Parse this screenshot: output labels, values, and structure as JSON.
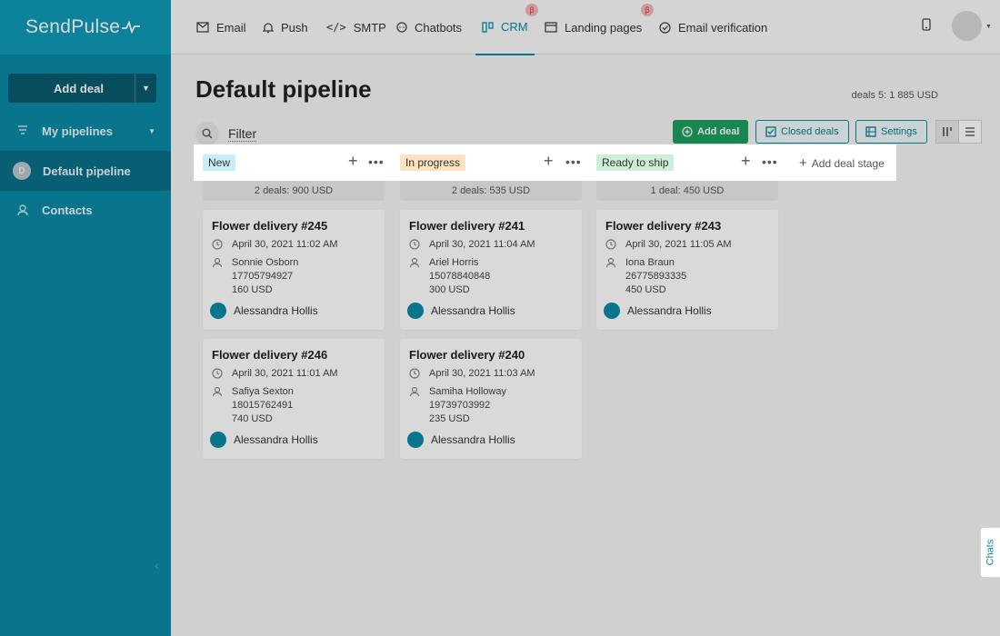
{
  "app": {
    "logo": "SendPulse"
  },
  "nav": {
    "email": "Email",
    "push": "Push",
    "smtp": "SMTP",
    "chatbots": "Chatbots",
    "crm": "CRM",
    "landing": "Landing pages",
    "verification": "Email verification",
    "beta": "β"
  },
  "sidebar": {
    "add_deal": "Add deal",
    "my_pipelines": "My pipelines",
    "default_pipeline": "Default pipeline",
    "pipeline_initial": "D",
    "contacts": "Contacts"
  },
  "page": {
    "title": "Default pipeline",
    "summary": "deals 5: 1 885 USD",
    "filter": "Filter"
  },
  "toolbar": {
    "add_deal": "Add deal",
    "closed_deals": "Closed deals",
    "settings": "Settings"
  },
  "stages": [
    {
      "name": "New",
      "color": "#c9eef7",
      "summary": "2 deals: 900 USD"
    },
    {
      "name": "In progress",
      "color": "#fbe3bf",
      "summary": "2 deals: 535 USD"
    },
    {
      "name": "Ready to ship",
      "color": "#cdeed8",
      "summary": "1 deal: 450 USD"
    }
  ],
  "add_stage": "Add deal stage",
  "cards": [
    {
      "title": "Flower delivery #245",
      "date": "April 30, 2021 11:02 AM",
      "contact": "Sonnie Osborn",
      "phone": "17705794927",
      "amount": "160 USD",
      "owner": "Alessandra Hollis"
    },
    {
      "title": "Flower delivery #246",
      "date": "April 30, 2021 11:01 AM",
      "contact": "Safiya Sexton",
      "phone": "18015762491",
      "amount": "740 USD",
      "owner": "Alessandra Hollis"
    },
    {
      "title": "Flower delivery #241",
      "date": "April 30, 2021 11:04 AM",
      "contact": "Ariel Horris",
      "phone": "15078840848",
      "amount": "300 USD",
      "owner": "Alessandra Hollis"
    },
    {
      "title": "Flower delivery #240",
      "date": "April 30, 2021 11:03 AM",
      "contact": "Samiha Holloway",
      "phone": "19739703992",
      "amount": "235 USD",
      "owner": "Alessandra Hollis"
    },
    {
      "title": "Flower delivery #243",
      "date": "April 30, 2021 11:05 AM",
      "contact": "Iona Braun",
      "phone": "26775893335",
      "amount": "450 USD",
      "owner": "Alessandra Hollis"
    }
  ],
  "chats": "Chats"
}
